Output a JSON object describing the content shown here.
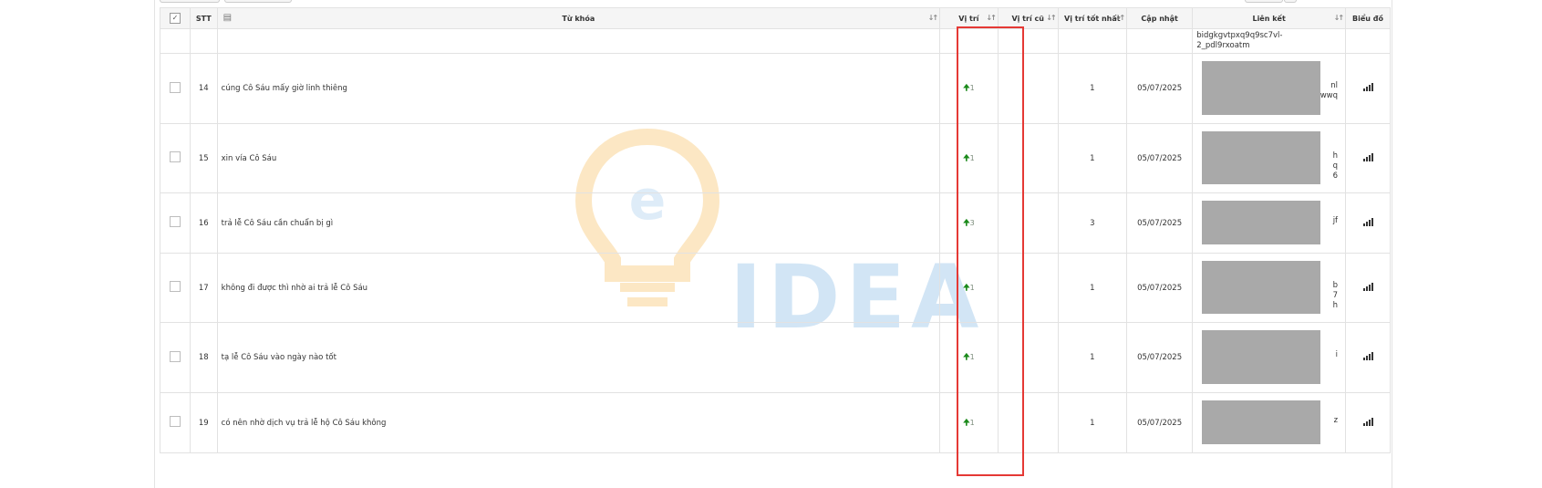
{
  "header": {
    "stt": "STT",
    "keyword": "Từ khóa",
    "position": "Vị trí",
    "old_position": "Vị trí cũ",
    "best_position": "Vị trí tốt nhất",
    "updated": "Cập nhật",
    "link": "Liên kết",
    "chart": "Biểu đồ"
  },
  "partial_row": {
    "link_text": "bidgkgvtpxq9q9sc7vl-\n2_pdl9rxoatm"
  },
  "rows": [
    {
      "stt": "14",
      "keyword": "cúng Cô Sáu mấy giờ linh thiêng",
      "position": "1",
      "best": "1",
      "updated": "05/07/2025",
      "link_tail": "nl\nwwq"
    },
    {
      "stt": "15",
      "keyword": "xin vía Cô Sáu",
      "position": "1",
      "best": "1",
      "updated": "05/07/2025",
      "link_tail": "h\nq\n6"
    },
    {
      "stt": "16",
      "keyword": "trả lễ Cô Sáu cần chuẩn bị gì",
      "position": "3",
      "best": "3",
      "updated": "05/07/2025",
      "link_tail": "jf"
    },
    {
      "stt": "17",
      "keyword": "không đi được thì nhờ ai trả lễ Cô Sáu",
      "position": "1",
      "best": "1",
      "updated": "05/07/2025",
      "link_tail": "b\n7\nh"
    },
    {
      "stt": "18",
      "keyword": "tạ lễ Cô Sáu vào ngày nào tốt",
      "position": "1",
      "best": "1",
      "updated": "05/07/2025",
      "link_tail": "i"
    },
    {
      "stt": "19",
      "keyword": "có nên nhờ dịch vụ trả lễ hộ Cô Sáu không",
      "position": "1",
      "best": "1",
      "updated": "05/07/2025",
      "link_tail": "z"
    }
  ],
  "watermark": {
    "text": "IDEA",
    "colors": {
      "bulb": "#f7b84b",
      "text": "#9cc7ea"
    }
  },
  "colors": {
    "arrow_up": "#1b8a1b",
    "highlight": "#e53935"
  },
  "icons": {
    "header_check": "checkbox-icon",
    "header_doc": "document-icon",
    "chart": "bar-chart-icon",
    "arrow": "arrow-up-icon"
  }
}
